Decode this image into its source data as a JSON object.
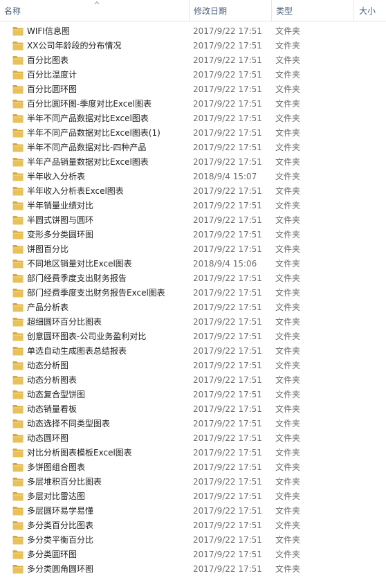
{
  "columns": {
    "name": "名称",
    "date": "修改日期",
    "type": "类型",
    "size": "大小"
  },
  "rows": [
    {
      "name": "WIFI信息图",
      "date": "2017/9/22 17:51",
      "type": "文件夹"
    },
    {
      "name": "XX公司年龄段的分布情况",
      "date": "2017/9/22 17:51",
      "type": "文件夹"
    },
    {
      "name": "百分比图表",
      "date": "2017/9/22 17:51",
      "type": "文件夹"
    },
    {
      "name": "百分比温度计",
      "date": "2017/9/22 17:51",
      "type": "文件夹"
    },
    {
      "name": "百分比圆环图",
      "date": "2017/9/22 17:51",
      "type": "文件夹"
    },
    {
      "name": "百分比圆环图-季度对比Excel图表",
      "date": "2017/9/22 17:51",
      "type": "文件夹"
    },
    {
      "name": "半年不同产品数据对比Excel图表",
      "date": "2017/9/22 17:51",
      "type": "文件夹"
    },
    {
      "name": "半年不同产品数据对比Excel图表(1)",
      "date": "2017/9/22 17:51",
      "type": "文件夹"
    },
    {
      "name": "半年不同产品数据对比-四种产品",
      "date": "2017/9/22 17:51",
      "type": "文件夹"
    },
    {
      "name": "半年产品销量数据对比Excel图表",
      "date": "2017/9/22 17:51",
      "type": "文件夹"
    },
    {
      "name": "半年收入分析表",
      "date": "2018/9/4 15:07",
      "type": "文件夹"
    },
    {
      "name": "半年收入分析表Excel图表",
      "date": "2017/9/22 17:51",
      "type": "文件夹"
    },
    {
      "name": "半年销量业绩对比",
      "date": "2017/9/22 17:51",
      "type": "文件夹"
    },
    {
      "name": "半圆式饼图与圆环",
      "date": "2017/9/22 17:51",
      "type": "文件夹"
    },
    {
      "name": "变形多分类圆环图",
      "date": "2017/9/22 17:51",
      "type": "文件夹"
    },
    {
      "name": "饼图百分比",
      "date": "2017/9/22 17:51",
      "type": "文件夹"
    },
    {
      "name": "不同地区销量对比Excel图表",
      "date": "2018/9/4 15:06",
      "type": "文件夹"
    },
    {
      "name": "部门经费季度支出财务报告",
      "date": "2017/9/22 17:51",
      "type": "文件夹"
    },
    {
      "name": "部门经费季度支出财务报告Excel图表",
      "date": "2017/9/22 17:51",
      "type": "文件夹"
    },
    {
      "name": "产品分析表",
      "date": "2017/9/22 17:51",
      "type": "文件夹"
    },
    {
      "name": "超细圆环百分比图表",
      "date": "2017/9/22 17:51",
      "type": "文件夹"
    },
    {
      "name": "创意圆环图表-公司业务盈利对比",
      "date": "2017/9/22 17:51",
      "type": "文件夹"
    },
    {
      "name": "单选自动生成图表总结报表",
      "date": "2017/9/22 17:51",
      "type": "文件夹"
    },
    {
      "name": "动态分析图",
      "date": "2017/9/22 17:51",
      "type": "文件夹"
    },
    {
      "name": "动态分析图表",
      "date": "2017/9/22 17:51",
      "type": "文件夹"
    },
    {
      "name": "动态复合型饼图",
      "date": "2017/9/22 17:51",
      "type": "文件夹"
    },
    {
      "name": "动态销量看板",
      "date": "2017/9/22 17:51",
      "type": "文件夹"
    },
    {
      "name": "动态选择不同类型图表",
      "date": "2017/9/22 17:51",
      "type": "文件夹"
    },
    {
      "name": "动态圆环图",
      "date": "2017/9/22 17:51",
      "type": "文件夹"
    },
    {
      "name": "对比分析图表模板Excel图表",
      "date": "2017/9/22 17:51",
      "type": "文件夹"
    },
    {
      "name": "多饼图组合图表",
      "date": "2017/9/22 17:51",
      "type": "文件夹"
    },
    {
      "name": "多层堆积百分比图表",
      "date": "2017/9/22 17:51",
      "type": "文件夹"
    },
    {
      "name": "多层对比雷达图",
      "date": "2017/9/22 17:51",
      "type": "文件夹"
    },
    {
      "name": "多层圆环易学易懂",
      "date": "2017/9/22 17:51",
      "type": "文件夹"
    },
    {
      "name": "多分类百分比图表",
      "date": "2017/9/22 17:51",
      "type": "文件夹"
    },
    {
      "name": "多分类平衡百分比",
      "date": "2017/9/22 17:51",
      "type": "文件夹"
    },
    {
      "name": "多分类圆环图",
      "date": "2017/9/22 17:51",
      "type": "文件夹"
    },
    {
      "name": "多分类圆角圆环图",
      "date": "2017/9/22 17:51",
      "type": "文件夹"
    }
  ],
  "colors": {
    "header_text": "#4c607a",
    "folder": "#e8c15a",
    "folder_dark": "#d9a43c"
  }
}
